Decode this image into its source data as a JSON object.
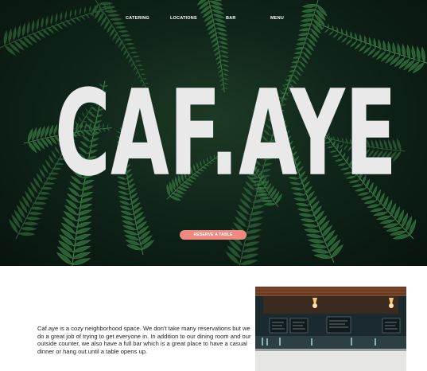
{
  "nav": {
    "items": [
      {
        "label": "CATERING"
      },
      {
        "label": "LOCATIONS"
      },
      {
        "label": "BAR"
      },
      {
        "label": "MENU"
      }
    ]
  },
  "hero": {
    "logo_text": "CAF.AYE",
    "cta_label": "RESERVE A TABLE",
    "background_icon": "fern-photo"
  },
  "about": {
    "text": "Caf.aye is a cozy neighborhood space. We don't take many reservations but we do a great job of trying to get everyone in. In addition to our dining room and our outside counter, we also have a full bar which is a great place to have a casual dinner or hang out until a table opens up."
  },
  "colors": {
    "accent": "#f08a80",
    "hero_dark": "#0b1a11",
    "fern": "#2f6b3a",
    "logo": "#e9e9e9"
  }
}
